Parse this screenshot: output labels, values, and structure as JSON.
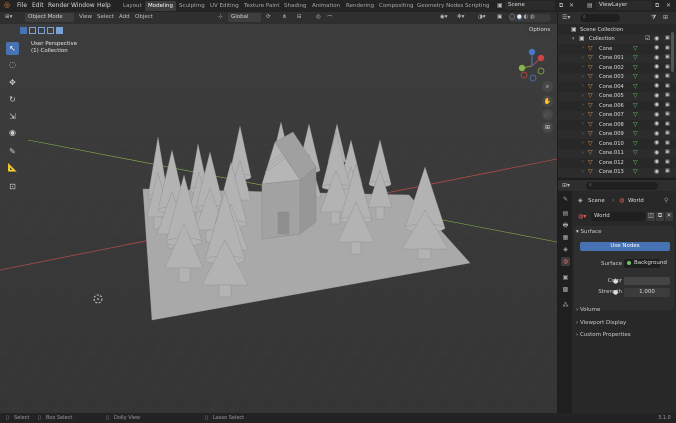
{
  "menu": [
    "File",
    "Edit",
    "Render",
    "Window",
    "Help"
  ],
  "workspaces": [
    "Layout",
    "Modeling",
    "Sculpting",
    "UV Editing",
    "Texture Paint",
    "Shading",
    "Animation",
    "Rendering",
    "Compositing",
    "Geometry Nodes",
    "Scripting"
  ],
  "active_workspace": "Modeling",
  "scene_name": "Scene",
  "view_layer": "ViewLayer",
  "viewport": {
    "mode": "Object Mode",
    "menus": [
      "View",
      "Select",
      "Add",
      "Object"
    ],
    "orientation": "Global",
    "options_label": "Options",
    "overlay_line1": "User Perspective",
    "overlay_line2": "(1) Collection"
  },
  "outliner": {
    "root": "Scene Collection",
    "collection": "Collection",
    "items": [
      "Cone",
      "Cone.001",
      "Cone.002",
      "Cone.003",
      "Cone.004",
      "Cone.005",
      "Cone.006",
      "Cone.007",
      "Cone.008",
      "Cone.009",
      "Cone.010",
      "Cone.011",
      "Cone.012",
      "Cone.013"
    ]
  },
  "properties": {
    "breadcrumb_scene": "Scene",
    "breadcrumb_world": "World",
    "world_name": "World",
    "surface_header": "Surface",
    "use_nodes_label": "Use Nodes",
    "surface_label": "Surface",
    "surface_value": "Background",
    "color_label": "Color",
    "strength_label": "Strength",
    "strength_value": "1.000",
    "volume_header": "Volume",
    "viewport_display_header": "Viewport Display",
    "custom_props_header": "Custom Properties"
  },
  "statusbar": {
    "select": "Select",
    "box_select": "Box Select",
    "dolly_view": "Dolly View",
    "lasso_select": "Lasso Select",
    "version": "3.1.0"
  },
  "colors": {
    "accent": "#4772b3",
    "viewport_bg": "#3a3a3a",
    "mesh": "#a8a8a8",
    "x_axis": "#b04a4a",
    "y_axis": "#8ab34a"
  }
}
